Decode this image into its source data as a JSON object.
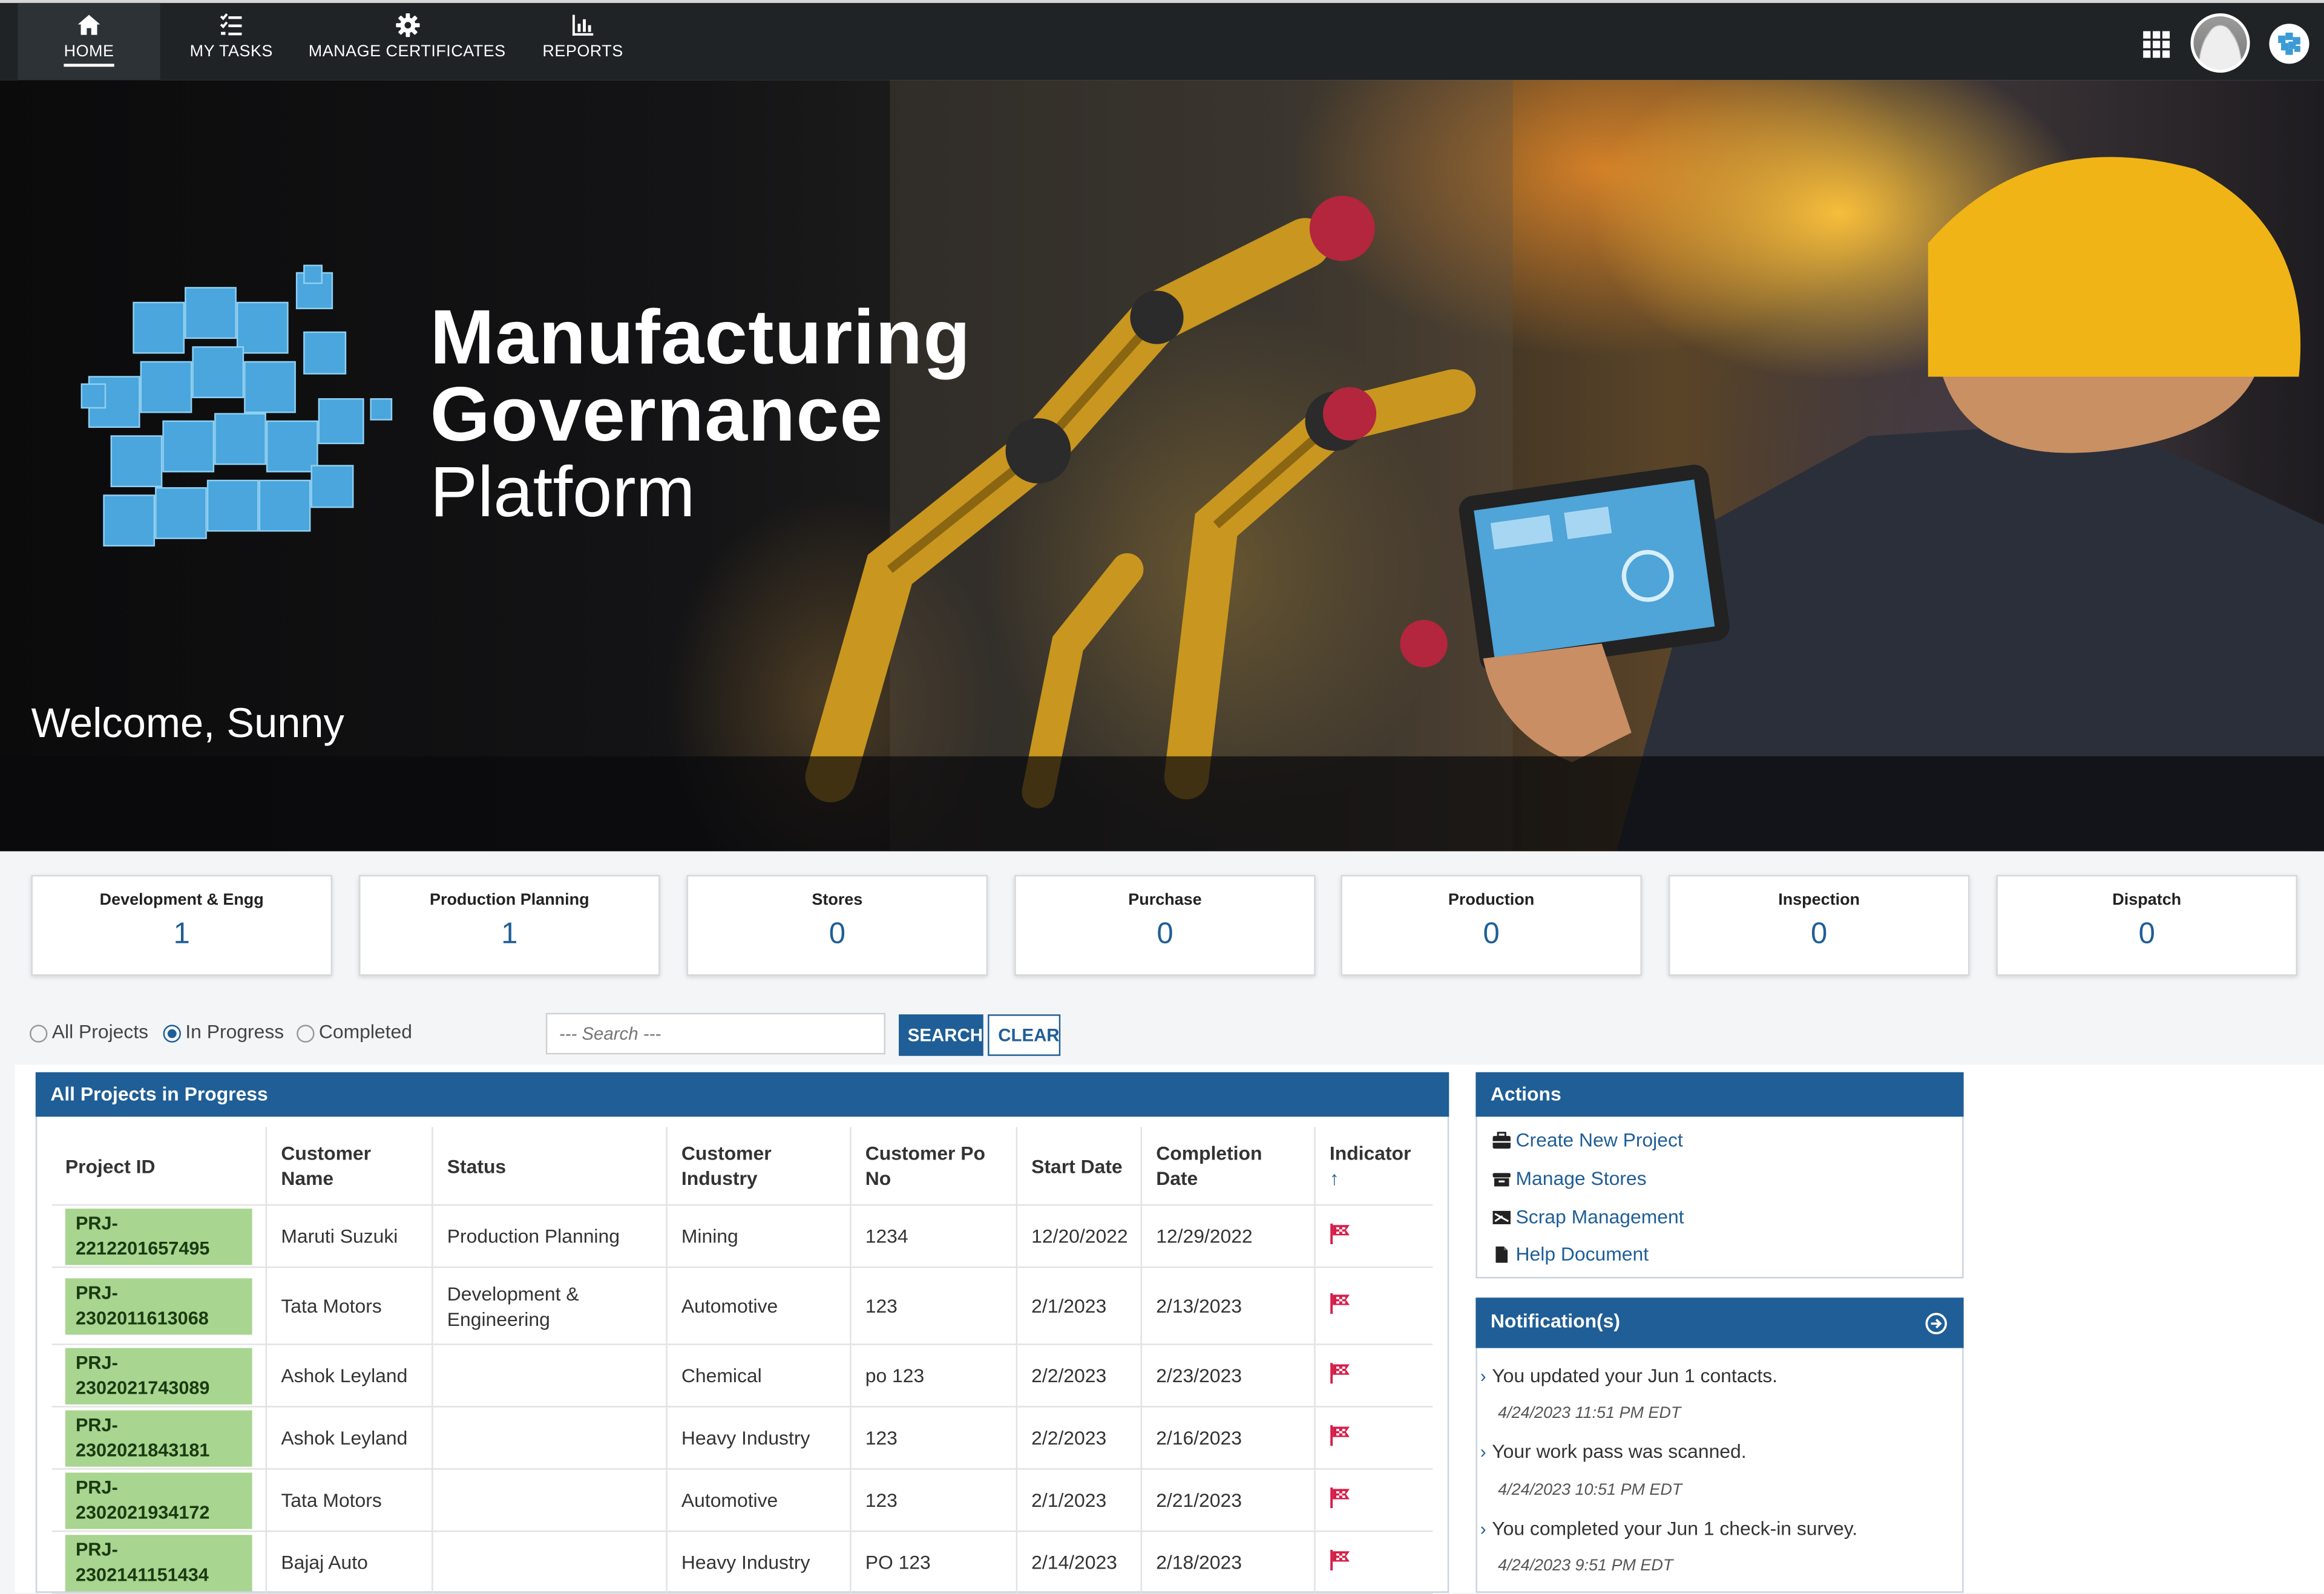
{
  "nav": {
    "items": [
      {
        "label": "HOME",
        "icon": "home-icon",
        "active": true
      },
      {
        "label": "MY TASKS",
        "icon": "tasks-list-icon"
      },
      {
        "label": "MANAGE CERTIFICATES",
        "icon": "gear-icon"
      },
      {
        "label": "REPORTS",
        "icon": "bar-chart-icon"
      }
    ]
  },
  "hero": {
    "brand_line1": "Manufacturing",
    "brand_line2": "Governance",
    "brand_line3": "Platform",
    "welcome": "Welcome, Sunny"
  },
  "stats": [
    {
      "title": "Development & Engg",
      "value": "1"
    },
    {
      "title": "Production Planning",
      "value": "1"
    },
    {
      "title": "Stores",
      "value": "0"
    },
    {
      "title": "Purchase",
      "value": "0"
    },
    {
      "title": "Production",
      "value": "0"
    },
    {
      "title": "Inspection",
      "value": "0"
    },
    {
      "title": "Dispatch",
      "value": "0"
    }
  ],
  "filters": {
    "all": "All Projects",
    "in_progress": "In Progress",
    "completed": "Completed",
    "selected": "In Progress",
    "search_placeholder": "--- Search ---",
    "search_button": "SEARCH",
    "clear_button": "CLEAR"
  },
  "projects": {
    "title": "All Projects in Progress",
    "columns": [
      "Project ID",
      "Customer Name",
      "Status",
      "Customer Industry",
      "Customer Po No",
      "Start Date",
      "Completion Date",
      "Indicator"
    ],
    "sort_indicator": "↑",
    "rows": [
      {
        "id": "PRJ-2212201657495",
        "customer": "Maruti Suzuki",
        "status": "Production Planning",
        "industry": "Mining",
        "po": "1234",
        "start": "12/20/2022",
        "completion": "12/29/2022"
      },
      {
        "id": "PRJ-2302011613068",
        "customer": "Tata Motors",
        "status": "Development & Engineering",
        "industry": "Automotive",
        "po": "123",
        "start": "2/1/2023",
        "completion": "2/13/2023"
      },
      {
        "id": "PRJ-2302021743089",
        "customer": "Ashok Leyland",
        "status": "",
        "industry": "Chemical",
        "po": "po 123",
        "start": "2/2/2023",
        "completion": "2/23/2023"
      },
      {
        "id": "PRJ-2302021843181",
        "customer": "Ashok Leyland",
        "status": "",
        "industry": "Heavy Industry",
        "po": "123",
        "start": "2/2/2023",
        "completion": "2/16/2023"
      },
      {
        "id": "PRJ-2302021934172",
        "customer": "Tata Motors",
        "status": "",
        "industry": "Automotive",
        "po": "123",
        "start": "2/1/2023",
        "completion": "2/21/2023"
      },
      {
        "id": "PRJ-2302141151434",
        "customer": "Bajaj Auto",
        "status": "",
        "industry": "Heavy Industry",
        "po": "PO 123",
        "start": "2/14/2023",
        "completion": "2/18/2023"
      }
    ]
  },
  "actions": {
    "title": "Actions",
    "items": [
      {
        "label": "Create New Project",
        "icon": "briefcase-icon"
      },
      {
        "label": "Manage Stores",
        "icon": "store-icon"
      },
      {
        "label": "Scrap Management",
        "icon": "scrap-icon"
      },
      {
        "label": "Help Document",
        "icon": "document-icon"
      }
    ]
  },
  "notifications": {
    "title": "Notification(s)",
    "items": [
      {
        "text": "You updated your Jun 1 contacts.",
        "time": "4/24/2023 11:51 PM EDT"
      },
      {
        "text": "Your work pass was scanned.",
        "time": "4/24/2023 10:51 PM EDT"
      },
      {
        "text": "You completed your Jun 1 check-in survey.",
        "time": "4/24/2023 9:51 PM EDT"
      }
    ]
  },
  "colors": {
    "primary": "#1f5e96",
    "nav_bg": "#1f2326",
    "project_badge": "#a8d58f",
    "flag": "#d61f4b"
  }
}
